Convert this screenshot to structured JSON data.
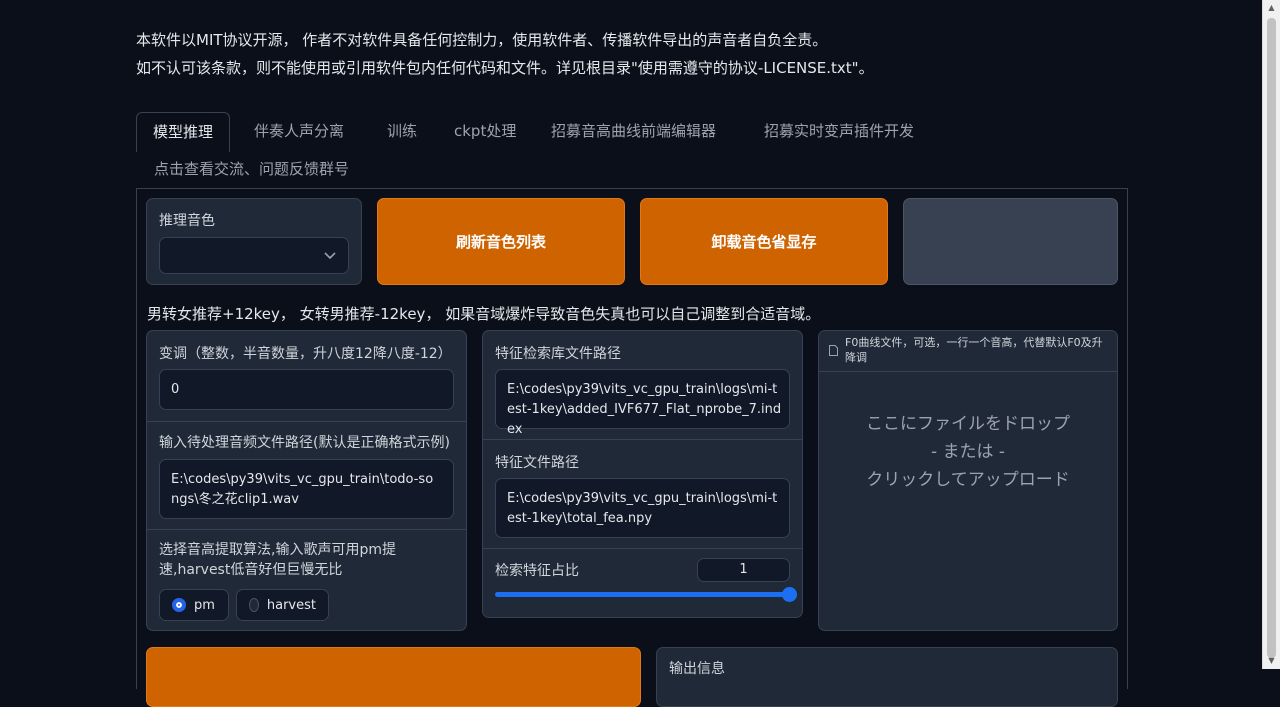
{
  "notice": {
    "line1": "本软件以MIT协议开源， 作者不对软件具备任何控制力，使用软件者、传播软件导出的声音者自负全责。",
    "line2": "如不认可该条款，则不能使用或引用软件包内任何代码和文件。详见根目录\"使用需遵守的协议-LICENSE.txt\"。"
  },
  "tabs": [
    {
      "label": "模型推理",
      "active": true
    },
    {
      "label": "伴奏人声分离"
    },
    {
      "label": "训练"
    },
    {
      "label": "ckpt处理"
    },
    {
      "label": "招募音高曲线前端编辑器"
    },
    {
      "label": "招募实时变声插件开发"
    },
    {
      "label": "点击查看交流、问题反馈群号"
    }
  ],
  "inference": {
    "voice_label": "推理音色",
    "voice_value": "",
    "refresh_label": "刷新音色列表",
    "unload_label": "卸载音色省显存",
    "hint": "男转女推荐+12key， 女转男推荐-12key， 如果音域爆炸导致音色失真也可以自己调整到合适音域。",
    "transpose_label": "变调（整数，半音数量，升八度12降八度-12）",
    "transpose_value": "0",
    "input_path_label": "输入待处理音频文件路径(默认是正确格式示例)",
    "input_path_value": "E:\\codes\\py39\\vits_vc_gpu_train\\todo-songs\\冬之花clip1.wav",
    "f0_method_label": "选择音高提取算法,输入歌声可用pm提速,harvest低音好但巨慢无比",
    "f0_options": [
      {
        "label": "pm",
        "selected": true
      },
      {
        "label": "harvest",
        "selected": false
      }
    ],
    "index_path_label": "特征检索库文件路径",
    "index_path_value": "E:\\codes\\py39\\vits_vc_gpu_train\\logs\\mi-test-1key\\added_IVF677_Flat_nprobe_7.index",
    "feature_path_label": "特征文件路径",
    "feature_path_value": "E:\\codes\\py39\\vits_vc_gpu_train\\logs\\mi-test-1key\\total_fea.npy",
    "ratio_label": "检索特征占比",
    "ratio_value": "1",
    "ratio_fraction": 1.0,
    "f0_file_label": "F0曲线文件，可选，一行一个音高，代替默认F0及升降调",
    "drop_line1": "ここにファイルをドロップ",
    "drop_line2": "- または -",
    "drop_line3": "クリックしてアップロード",
    "output_label": "输出信息"
  },
  "colors": {
    "accent": "#cf6300",
    "slider": "#1d6ff2"
  }
}
